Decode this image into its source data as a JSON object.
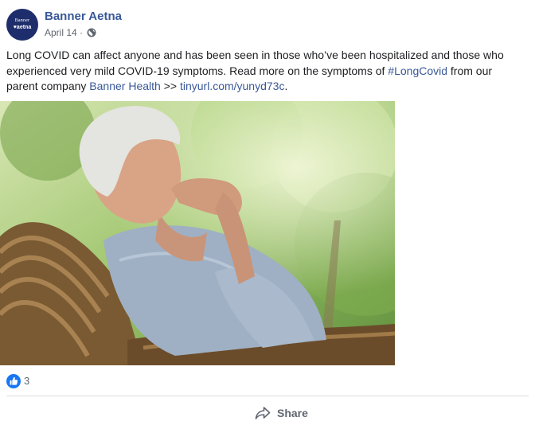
{
  "post": {
    "author": {
      "name": "Banner Aetna",
      "avatar_line1": "Banner",
      "avatar_line2": "♥aetna"
    },
    "date": "April 14",
    "separator": "·",
    "privacy_icon": "globe-icon",
    "text": {
      "part1": "Long COVID can affect anyone and has been seen in those who’ve been hospitalized and those who experienced very mild COVID-19 symptoms. Read more on the symptoms of ",
      "hashtag": "#LongCovid",
      "part2": " from our parent company ",
      "mention": "Banner Health",
      "part3": " >> ",
      "url": "tinyurl.com/yunyd73c",
      "part4": "."
    },
    "reactions": {
      "icon": "like-icon",
      "count": "3"
    },
    "actions": {
      "share_label": "Share",
      "share_icon": "share-icon"
    }
  },
  "colors": {
    "link": "#385898",
    "like": "#1877f2",
    "avatar_bg": "#1e2d6b",
    "muted": "#606770"
  }
}
